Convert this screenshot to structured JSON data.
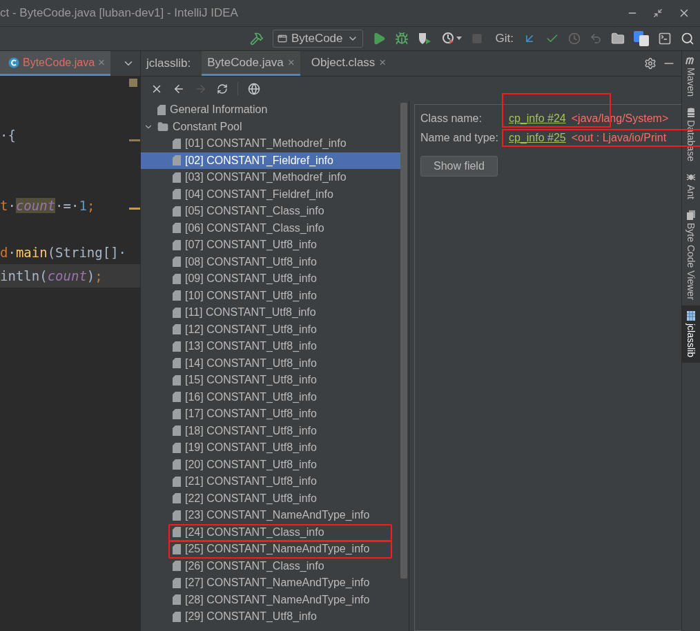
{
  "window": {
    "title": "ct - ByteCode.java [luban-dev1] - IntelliJ IDEA"
  },
  "toolbar": {
    "run_config": "ByteCode",
    "git_label": "Git:"
  },
  "editor": {
    "tab": {
      "label": "ByteCode.java",
      "close": "×",
      "selected": true
    },
    "lines": [
      {
        "current": false,
        "tokens": [
          {
            "text": "·{",
            "kind": "plain"
          }
        ]
      },
      {
        "current": false
      },
      {
        "current": false
      },
      {
        "current": false,
        "tokens": [
          {
            "text": "t",
            "kind": "keyword"
          },
          {
            "text": "·",
            "kind": "plain"
          },
          {
            "text": "count",
            "kind": "field-match"
          },
          {
            "text": "·=·",
            "kind": "plain"
          },
          {
            "text": "1",
            "kind": "number"
          },
          {
            "text": ";",
            "kind": "keyword"
          }
        ]
      },
      {
        "current": false
      },
      {
        "current": false,
        "tokens": [
          {
            "text": "d",
            "kind": "keyword"
          },
          {
            "text": "·",
            "kind": "plain"
          },
          {
            "text": "main",
            "kind": "method"
          },
          {
            "text": "(String[]·",
            "kind": "plain"
          }
        ]
      },
      {
        "current": true,
        "tokens": [
          {
            "text": "intln(",
            "kind": "plain"
          },
          {
            "text": "count",
            "kind": "field"
          },
          {
            "text": ")",
            "kind": "plain"
          },
          {
            "text": ";",
            "kind": "keyword"
          }
        ]
      }
    ]
  },
  "jclasslib": {
    "label": "jclasslib:",
    "tabs": [
      {
        "label": "ByteCode.java",
        "close": "×",
        "selected": true
      },
      {
        "label": "Object.class",
        "close": "×",
        "selected": false
      }
    ]
  },
  "tree": [
    {
      "label": "General Information",
      "kind": "file",
      "selected": false
    },
    {
      "label": "Constant Pool",
      "kind": "folder",
      "selected": false,
      "expanded": true,
      "children": [
        {
          "label": "[01] CONSTANT_Methodref_info",
          "selected": false,
          "marked": false
        },
        {
          "label": "[02] CONSTANT_Fieldref_info",
          "selected": true,
          "marked": false
        },
        {
          "label": "[03] CONSTANT_Methodref_info",
          "selected": false,
          "marked": false
        },
        {
          "label": "[04] CONSTANT_Fieldref_info",
          "selected": false,
          "marked": false
        },
        {
          "label": "[05] CONSTANT_Class_info",
          "selected": false,
          "marked": false
        },
        {
          "label": "[06] CONSTANT_Class_info",
          "selected": false,
          "marked": false
        },
        {
          "label": "[07] CONSTANT_Utf8_info",
          "selected": false,
          "marked": false
        },
        {
          "label": "[08] CONSTANT_Utf8_info",
          "selected": false,
          "marked": false
        },
        {
          "label": "[09] CONSTANT_Utf8_info",
          "selected": false,
          "marked": false
        },
        {
          "label": "[10] CONSTANT_Utf8_info",
          "selected": false,
          "marked": false
        },
        {
          "label": "[11] CONSTANT_Utf8_info",
          "selected": false,
          "marked": false
        },
        {
          "label": "[12] CONSTANT_Utf8_info",
          "selected": false,
          "marked": false
        },
        {
          "label": "[13] CONSTANT_Utf8_info",
          "selected": false,
          "marked": false
        },
        {
          "label": "[14] CONSTANT_Utf8_info",
          "selected": false,
          "marked": false
        },
        {
          "label": "[15] CONSTANT_Utf8_info",
          "selected": false,
          "marked": false
        },
        {
          "label": "[16] CONSTANT_Utf8_info",
          "selected": false,
          "marked": false
        },
        {
          "label": "[17] CONSTANT_Utf8_info",
          "selected": false,
          "marked": false
        },
        {
          "label": "[18] CONSTANT_Utf8_info",
          "selected": false,
          "marked": false
        },
        {
          "label": "[19] CONSTANT_Utf8_info",
          "selected": false,
          "marked": false
        },
        {
          "label": "[20] CONSTANT_Utf8_info",
          "selected": false,
          "marked": false
        },
        {
          "label": "[21] CONSTANT_Utf8_info",
          "selected": false,
          "marked": false
        },
        {
          "label": "[22] CONSTANT_Utf8_info",
          "selected": false,
          "marked": false
        },
        {
          "label": "[23] CONSTANT_NameAndType_info",
          "selected": false,
          "marked": false
        },
        {
          "label": "[24] CONSTANT_Class_info",
          "selected": false,
          "marked": true
        },
        {
          "label": "[25] CONSTANT_NameAndType_info",
          "selected": false,
          "marked": true
        },
        {
          "label": "[26] CONSTANT_Class_info",
          "selected": false,
          "marked": false
        },
        {
          "label": "[27] CONSTANT_NameAndType_info",
          "selected": false,
          "marked": false
        },
        {
          "label": "[28] CONSTANT_NameAndType_info",
          "selected": false,
          "marked": false
        },
        {
          "label": "[29] CONSTANT_Utf8_info",
          "selected": false,
          "marked": false
        }
      ]
    }
  ],
  "details": [
    {
      "label": "Class name:",
      "link": "cp_info #24",
      "comment": "<java/lang/System>",
      "marked": true
    },
    {
      "label": "Name and type:",
      "link": "cp_info #25",
      "comment": "<out : Ljava/io/Print",
      "marked": true
    }
  ],
  "detail_button": "Show field",
  "side_tools": [
    {
      "label": "Maven",
      "kind": "maven",
      "selected": false
    },
    {
      "label": "Database",
      "kind": "database",
      "selected": false
    },
    {
      "label": "Ant",
      "kind": "ant",
      "selected": false
    },
    {
      "label": "Byte Code Viewer",
      "kind": "viewer",
      "selected": false
    },
    {
      "label": "jclasslib",
      "kind": "jclasslib",
      "selected": true
    }
  ]
}
